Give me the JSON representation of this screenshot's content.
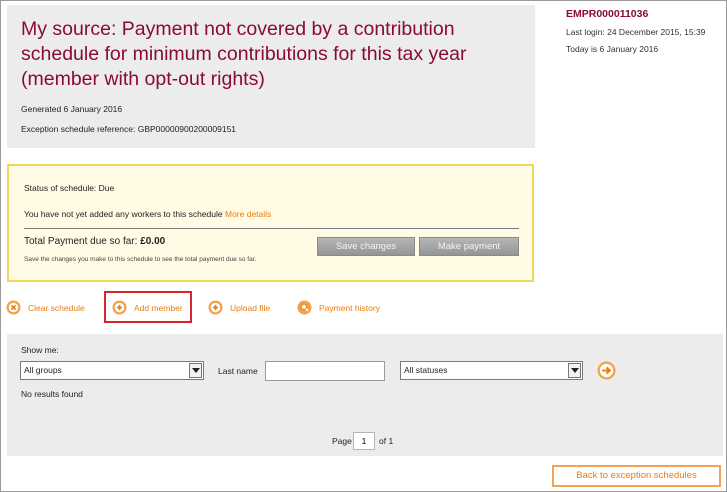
{
  "header": {
    "title": "My source: Payment not covered by a contribution schedule for minimum contributions for this tax year (member with opt-out rights)",
    "generated": "Generated 6 January 2016",
    "reference": "Exception schedule reference: GBP00000900200009151"
  },
  "account": {
    "employer_ref": "EMPR000011036",
    "last_login": "Last login: 24 December 2015, 15:39",
    "today": "Today is 6 January 2016"
  },
  "status": {
    "status_text": "Status of schedule: Due",
    "workers_text": "You have not yet added any workers to this schedule",
    "more_details": "More details",
    "total_label": "Total Payment due so far:",
    "total_amount": "£0.00",
    "save_note": "Save the changes you make to this schedule to see the total payment due so far.",
    "save_button": "Save changes",
    "pay_button": "Make payment"
  },
  "actions": {
    "clear": "Clear schedule",
    "add": "Add member",
    "upload": "Upload file",
    "history": "Payment history"
  },
  "filter": {
    "show_me": "Show me:",
    "groups_value": "All groups",
    "lastname_label": "Last name",
    "lastname_value": "",
    "status_value": "All statuses",
    "no_results": "No results found",
    "page_label": "Page",
    "page_value": "1",
    "page_of": "of 1"
  },
  "footer": {
    "back_button": "Back to exception schedules"
  },
  "colors": {
    "brand": "#8a0a3a",
    "accent": "#e87d0e",
    "highlight": "#d9242e"
  },
  "icons": {
    "clear": "x-circle-icon",
    "add": "plus-circle-icon",
    "upload": "plus-circle-icon",
    "history": "search-circle-icon",
    "go": "arrow-right-circle-icon"
  }
}
